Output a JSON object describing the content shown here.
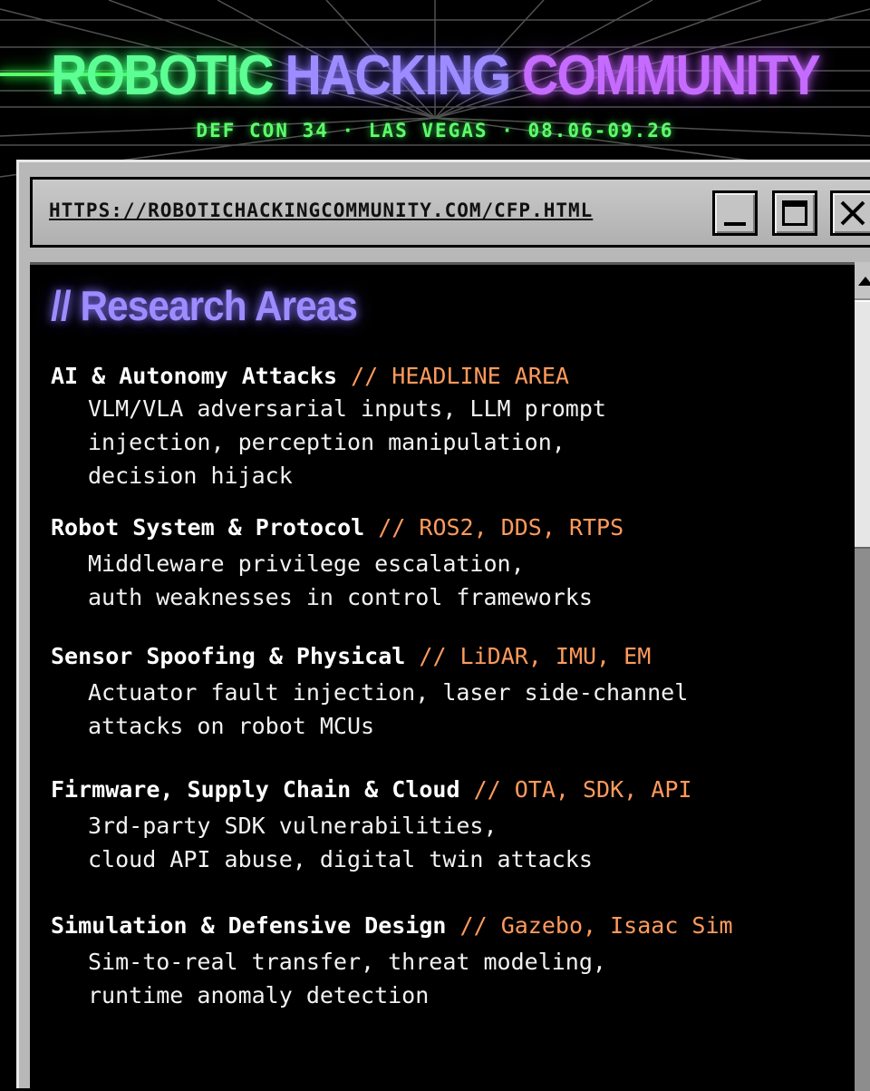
{
  "header": {
    "title_part1": "ROBOTIC",
    "title_part2": "HACKING",
    "title_part3": "COMMUNITY",
    "subtitle": "DEF CON 34 · LAS VEGAS · 08.06-09.26"
  },
  "window": {
    "url": "HTTPS://ROBOTICHACKINGCOMMUNITY.COM/CFP.HTML",
    "buttons": [
      "minimize-icon",
      "maximize-icon",
      "close-icon"
    ]
  },
  "main": {
    "heading": "// Research Areas",
    "areas": [
      {
        "name": "AI & Autonomy Attacks",
        "tag": " // HEADLINE AREA",
        "desc": [
          "VLM/VLA adversarial inputs, LLM prompt",
          "injection, perception manipulation,",
          "decision hijack"
        ]
      },
      {
        "name": "Robot System & Protocol",
        "tag": " // ROS2, DDS, RTPS",
        "desc": [
          "Middleware privilege escalation,",
          "auth weaknesses in control frameworks"
        ]
      },
      {
        "name": "Sensor Spoofing & Physical",
        "tag": " // LiDAR, IMU, EM",
        "desc": [
          "Actuator fault injection, laser side-channel",
          "attacks on robot MCUs"
        ]
      },
      {
        "name": "Firmware, Supply Chain & Cloud",
        "tag": " // OTA, SDK, API",
        "desc": [
          "3rd-party SDK vulnerabilities,",
          "cloud API abuse, digital twin attacks"
        ]
      },
      {
        "name": "Simulation & Defensive Design",
        "tag": " // Gazebo, Isaac Sim",
        "desc": [
          "Sim-to-real transfer, threat modeling,",
          "runtime anomaly detection"
        ]
      }
    ]
  },
  "colors": {
    "background": "#000000",
    "title_green": "#5dff95",
    "title_blue": "#9d8cff",
    "title_purple": "#c56bff",
    "tag_orange": "#ff9a5c",
    "window_gray": "#b8b8b8"
  }
}
